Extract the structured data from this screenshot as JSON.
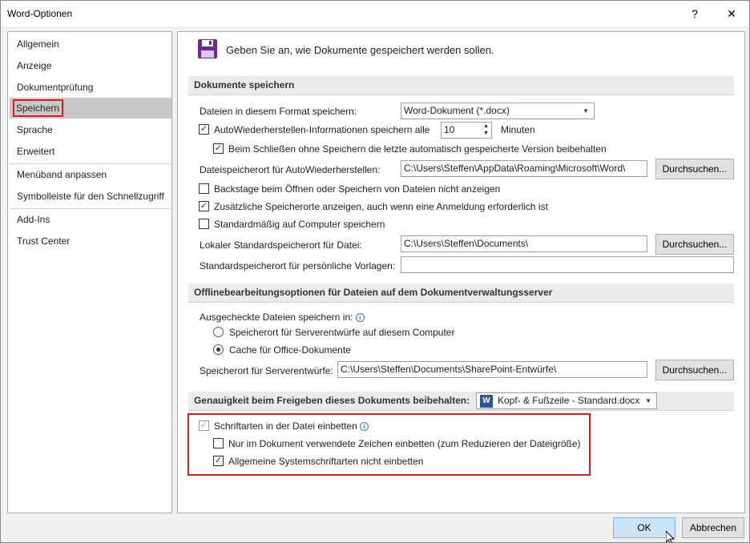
{
  "window": {
    "title": "Word-Optionen",
    "help": "?",
    "close": "✕"
  },
  "sidebar": {
    "items": [
      {
        "label": "Allgemein"
      },
      {
        "label": "Anzeige"
      },
      {
        "label": "Dokumentprüfung"
      },
      {
        "label": "Speichern",
        "selected": true
      },
      {
        "label": "Sprache"
      },
      {
        "label": "Erweitert"
      },
      {
        "label": "Menüband anpassen"
      },
      {
        "label": "Symbolleiste für den Schnellzugriff"
      },
      {
        "label": "Add-Ins"
      },
      {
        "label": "Trust Center"
      }
    ]
  },
  "intro": {
    "text": "Geben Sie an, wie Dokumente gespeichert werden sollen."
  },
  "save_docs": {
    "header": "Dokumente speichern",
    "format_label": "Dateien in diesem Format speichern:",
    "format_value": "Word-Dokument (*.docx)",
    "autorecover_label": "AutoWiederherstellen-Informationen speichern alle",
    "autorecover_checked": true,
    "autorecover_minutes": "10",
    "minutes_label": "Minuten",
    "keep_last_label": "Beim Schließen ohne Speichern die letzte automatisch gespeicherte Version beibehalten",
    "keep_last_checked": true,
    "autorecover_location_label": "Dateispeicherort für AutoWiederherstellen:",
    "autorecover_location_value": "C:\\Users\\Steffen\\AppData\\Roaming\\Microsoft\\Word\\",
    "browse_label": "Durchsuchen...",
    "backstage_label": "Backstage beim Öffnen oder Speichern von Dateien nicht anzeigen",
    "backstage_checked": false,
    "additional_locations_label": "Zusätzliche Speicherorte anzeigen, auch wenn eine Anmeldung erforderlich ist",
    "additional_locations_checked": true,
    "default_computer_label": "Standardmäßig auf Computer speichern",
    "default_computer_checked": false,
    "local_default_label": "Lokaler Standardspeicherort für Datei:",
    "local_default_value": "C:\\Users\\Steffen\\Documents\\",
    "templates_label": "Standardspeicherort für persönliche Vorlagen:",
    "templates_value": ""
  },
  "offline": {
    "header": "Offlinebearbeitungsoptionen für Dateien auf dem Dokumentverwaltungsserver",
    "checked_out_label": "Ausgecheckte Dateien speichern in:",
    "info_icon": "i",
    "option_server_label": "Speicherort für Serverentwürfe auf diesem Computer",
    "option_cache_label": "Cache für Office-Dokumente",
    "selected": "cache",
    "server_drafts_label": "Speicherort für Serverentwürfe:",
    "server_drafts_value": "C:\\Users\\Steffen\\Documents\\SharePoint-Entwürfe\\",
    "browse_label": "Durchsuchen..."
  },
  "fidelity": {
    "header": "Genauigkeit beim Freigeben dieses Dokuments beibehalten:",
    "document_value": "Kopf- & Fußzeile - Standard.docx",
    "embed_fonts_label": "Schriftarten in der Datei einbetten",
    "embed_fonts_checked": true,
    "only_used_label": "Nur im Dokument verwendete Zeichen einbetten (zum Reduzieren der Dateigröße)",
    "only_used_checked": false,
    "no_system_label": "Allgemeine Systemschriftarten nicht einbetten",
    "no_system_checked": true
  },
  "footer": {
    "ok_label": "OK",
    "cancel_label": "Abbrechen"
  },
  "colors": {
    "accent": "#6a2c91",
    "highlight_red": "#d42020",
    "selected_nav": "#c8c8c8"
  }
}
